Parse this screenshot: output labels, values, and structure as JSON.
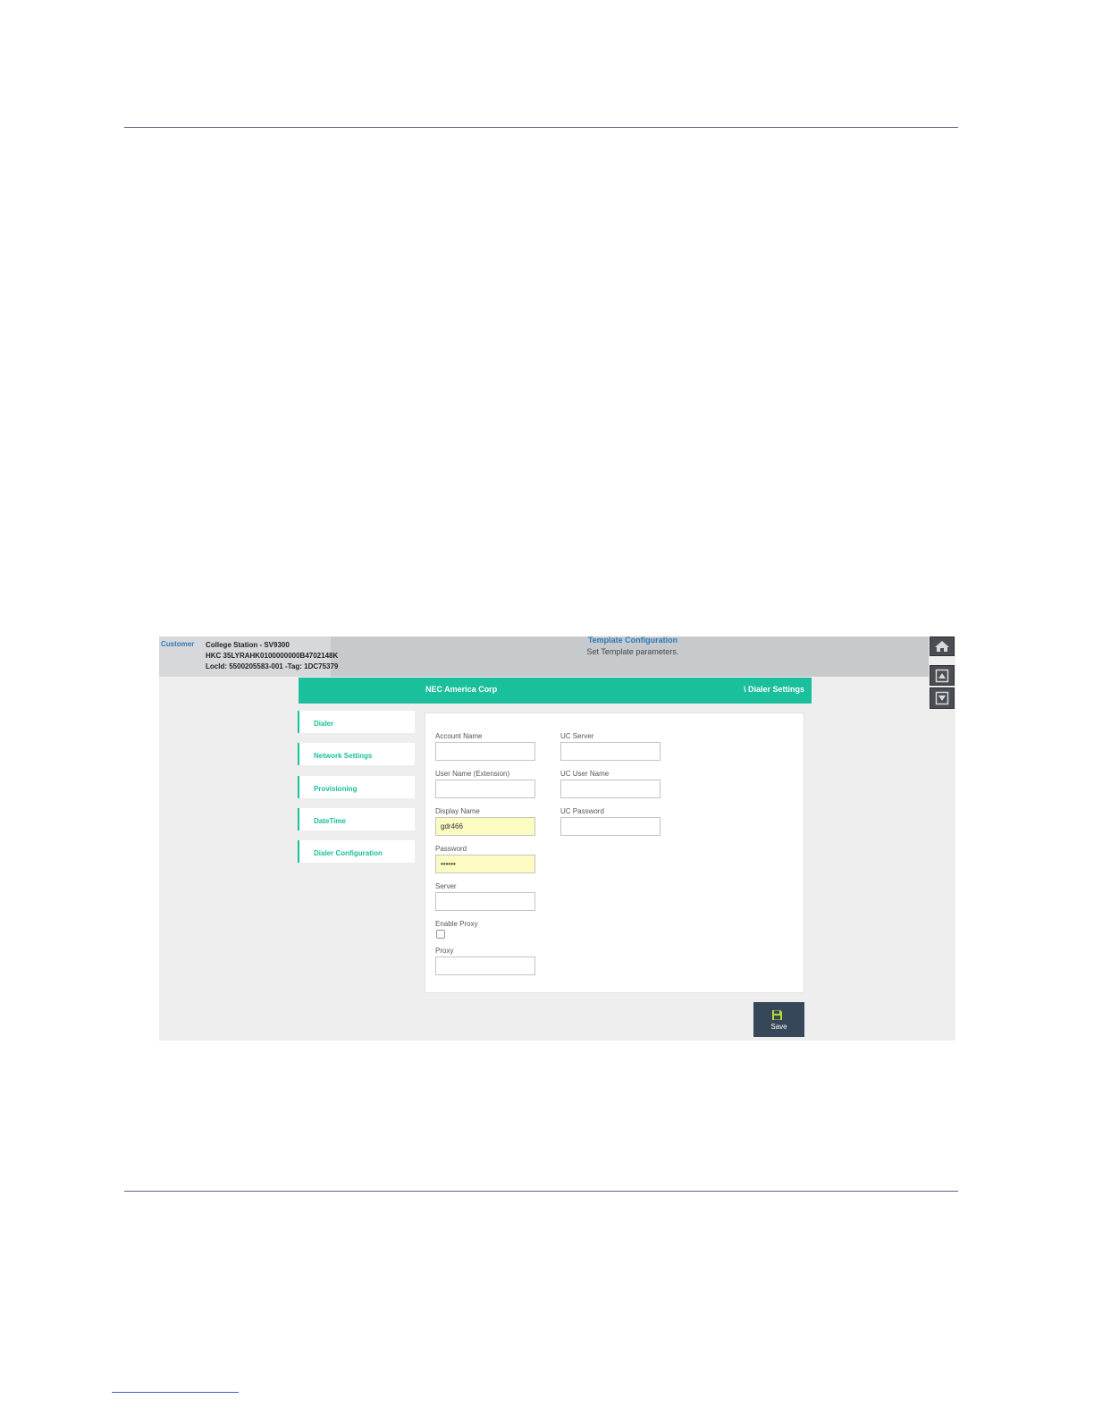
{
  "customer": {
    "label": "Customer",
    "line1": "College Station - SV9300",
    "line2": "HKC 35LYRAHK0100000000B4702148K",
    "line3": "LocId: 5500205583-001 -Tag: 1DC75379"
  },
  "header": {
    "title": "Template Configuration",
    "subtitle": "Set Template parameters."
  },
  "toolbar": {
    "org_name": "NEC America Corp",
    "breadcrumb": "\\ Dialer Settings"
  },
  "menu": {
    "items": [
      {
        "label": "Dialer"
      },
      {
        "label": "Network Settings"
      },
      {
        "label": "Provisioning"
      },
      {
        "label": "DateTime"
      },
      {
        "label": "Dialer Configuration"
      }
    ]
  },
  "form": {
    "account_name": {
      "label": "Account Name",
      "value": ""
    },
    "user_name": {
      "label": "User Name (Extension)",
      "value": ""
    },
    "display_name": {
      "label": "Display Name",
      "value": "gdr466"
    },
    "password": {
      "label": "Password",
      "value": "••••••"
    },
    "server": {
      "label": "Server",
      "value": ""
    },
    "enable_proxy": {
      "label": "Enable Proxy",
      "checked": false
    },
    "proxy": {
      "label": "Proxy",
      "value": ""
    },
    "uc_server": {
      "label": "UC Server",
      "value": ""
    },
    "uc_user_name": {
      "label": "UC User Name",
      "value": ""
    },
    "uc_password": {
      "label": "UC Password",
      "value": ""
    }
  },
  "actions": {
    "save_label": "Save"
  },
  "colors": {
    "accent": "#1abf9b",
    "link": "#2f78b8",
    "dark_button": "#37475a",
    "autofill": "#fbfbc2"
  },
  "icons": {
    "home": "home-icon",
    "scroll_up": "arrow-up-icon",
    "scroll_down": "arrow-down-icon",
    "save": "floppy-disk-icon"
  }
}
